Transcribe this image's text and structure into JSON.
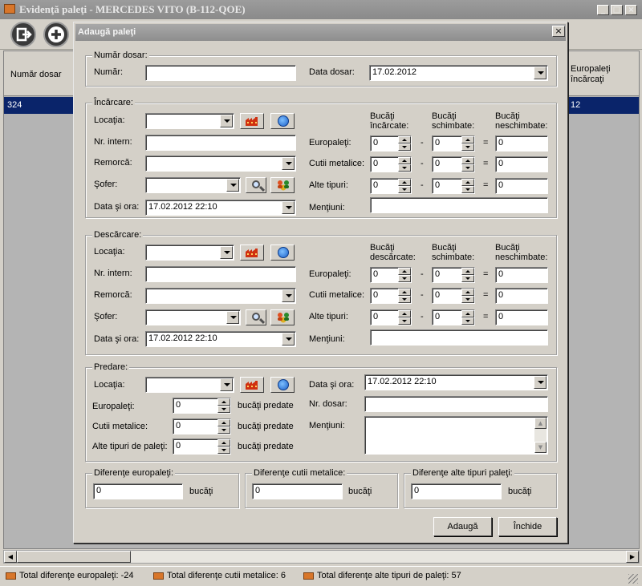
{
  "main_window": {
    "title": "Evidenţă paleţi - MERCEDES VITO (B-112-QOE)",
    "title_buttons": [
      "_",
      "□",
      "×"
    ],
    "toolbar": {
      "back_icon": "exit-icon",
      "add_icon": "plus-icon"
    },
    "grid": {
      "col_numar_dosar": "Număr dosar",
      "col_europaleti_incarcati": "Europaleţi încărcaţi",
      "row": {
        "numar_dosar": "324",
        "europaleti_incarcati": "12"
      }
    }
  },
  "status": {
    "europaleti": "Total diferenţe europaleţi: -24",
    "cutii": "Total diferenţe cutii metalice: 6",
    "alte": "Total diferenţe alte tipuri de paleţi: 57"
  },
  "dialog": {
    "title": "Adaugă paleţi",
    "close": "×",
    "numar_dosar": {
      "legend": "Număr dosar:",
      "numar_label": "Număr:",
      "numar_value": "",
      "data_label": "Data dosar:",
      "data_value": "17.02.2012"
    },
    "incarcare": {
      "legend": "Încărcare:",
      "locatia": "Locaţia:",
      "nr_intern": "Nr. intern:",
      "remorca": "Remorcă:",
      "sofer": "Şofer:",
      "data_ora": "Data şi ora:",
      "data_ora_value": "17.02.2012 22:10",
      "hdr1": "Bucăţi\nîncărcate:",
      "hdr2": "Bucăţi\nschimbate:",
      "hdr3": "Bucăţi\nneschimbate:",
      "europaleti": "Europaleţi:",
      "cutii": "Cutii metalice:",
      "alte": "Alte tipuri:",
      "mentiuni": "Menţiuni:",
      "rows": [
        {
          "a": "0",
          "b": "0",
          "c": "0"
        },
        {
          "a": "0",
          "b": "0",
          "c": "0"
        },
        {
          "a": "0",
          "b": "0",
          "c": "0"
        }
      ]
    },
    "descarcare": {
      "legend": "Descărcare:",
      "locatia": "Locaţia:",
      "nr_intern": "Nr. intern:",
      "remorca": "Remorcă:",
      "sofer": "Şofer:",
      "data_ora": "Data şi ora:",
      "data_ora_value": "17.02.2012 22:10",
      "hdr1": "Bucăţi\ndescărcate:",
      "hdr2": "Bucăţi\nschimbate:",
      "hdr3": "Bucăţi\nneschimbate:",
      "europaleti": "Europaleţi:",
      "cutii": "Cutii metalice:",
      "alte": "Alte tipuri:",
      "mentiuni": "Menţiuni:",
      "rows": [
        {
          "a": "0",
          "b": "0",
          "c": "0"
        },
        {
          "a": "0",
          "b": "0",
          "c": "0"
        },
        {
          "a": "0",
          "b": "0",
          "c": "0"
        }
      ]
    },
    "predare": {
      "legend": "Predare:",
      "locatia": "Locaţia:",
      "europaleti": "Europaleţi:",
      "cutii": "Cutii metalice:",
      "alte": "Alte tipuri de paleţi:",
      "suffix": "bucăţi predate",
      "europaleti_value": "0",
      "cutii_value": "0",
      "alte_value": "0",
      "data_ora": "Data şi ora:",
      "data_ora_value": "17.02.2012 22:10",
      "nr_dosar": "Nr. dosar:",
      "mentiuni": "Menţiuni:"
    },
    "diferente": {
      "europaleti_legend": "Diferenţe europaleţi:",
      "cutii_legend": "Diferenţe cutii metalice:",
      "alte_legend": "Diferenţe alte tipuri paleţi:",
      "europaleti_value": "0",
      "cutii_value": "0",
      "alte_value": "0",
      "unit": "bucăţi"
    },
    "buttons": {
      "add": "Adaugă",
      "close": "Închide"
    }
  },
  "colors": {
    "selection": "#0a246a",
    "title_bar": "#8e8e8e",
    "face": "#d4d0c8"
  }
}
